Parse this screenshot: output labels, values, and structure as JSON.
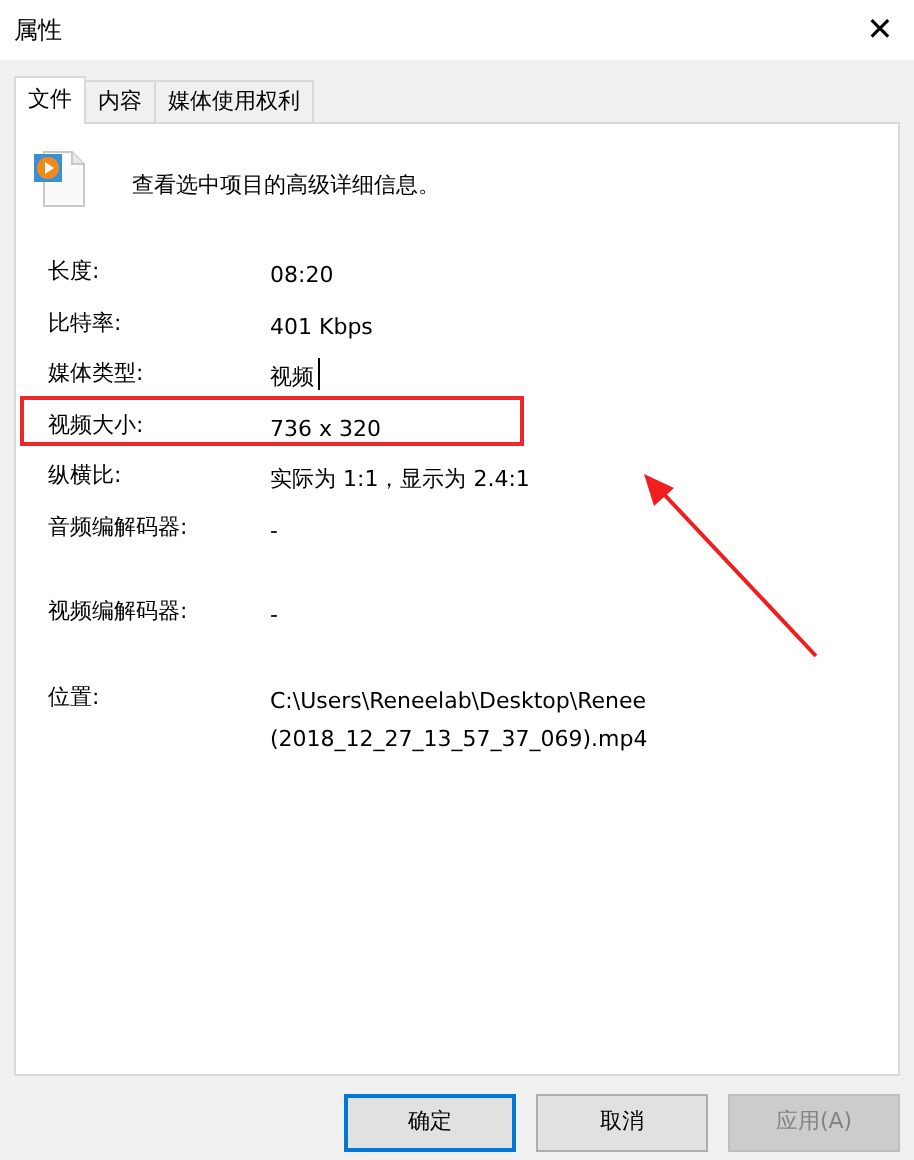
{
  "window": {
    "title": "属性",
    "close": "✕"
  },
  "tabs": [
    {
      "label": "文件",
      "selected": true
    },
    {
      "label": "内容",
      "selected": false
    },
    {
      "label": "媒体使用权利",
      "selected": false
    }
  ],
  "header": {
    "description": "查看选中项目的高级详细信息。"
  },
  "properties": [
    {
      "label": "长度:",
      "value": "08:20",
      "highlighted": false,
      "text_cursor": false
    },
    {
      "label": "比特率:",
      "value": "401 Kbps",
      "highlighted": false,
      "text_cursor": false
    },
    {
      "label": "媒体类型:",
      "value": "视频",
      "highlighted": false,
      "text_cursor": true
    },
    {
      "label": "视频大小:",
      "value": "736 x 320",
      "highlighted": true,
      "text_cursor": false
    },
    {
      "label": "纵横比:",
      "value": "实际为 1:1，显示为 2.4:1",
      "highlighted": false,
      "text_cursor": false
    },
    {
      "label": "音频编解码器:",
      "value": "-",
      "highlighted": false,
      "text_cursor": false
    },
    {
      "label": "视频编解码器:",
      "value": "-",
      "highlighted": false,
      "text_cursor": false
    },
    {
      "label": "位置:",
      "value": "C:\\Users\\Reneelab\\Desktop\\Renee (2018_12_27_13_57_37_069).mp4",
      "highlighted": false,
      "text_cursor": false
    }
  ],
  "buttons": [
    {
      "label": "确定",
      "default": true,
      "disabled": false
    },
    {
      "label": "取消",
      "default": false,
      "disabled": false
    },
    {
      "label": "应用(A)",
      "default": false,
      "disabled": true
    }
  ]
}
